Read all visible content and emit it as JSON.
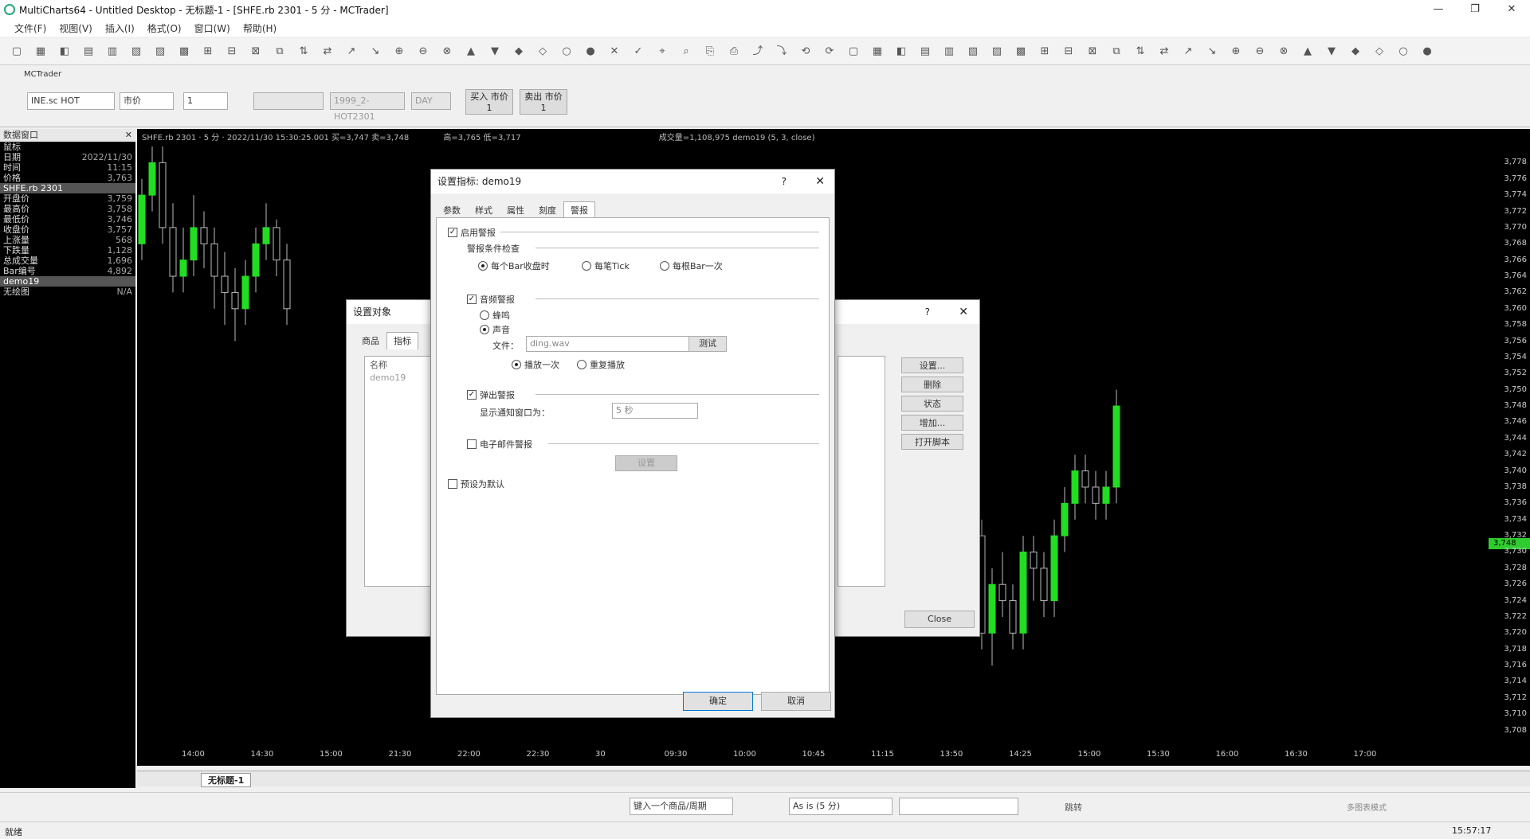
{
  "window": {
    "title": "MultiCharts64 - Untitled Desktop - 无标题-1 - [SHFE.rb 2301 - 5 分 - MCTrader]"
  },
  "menu": [
    "文件(F)",
    "视图(V)",
    "插入(I)",
    "格式(O)",
    "窗口(W)",
    "帮助(H)"
  ],
  "trade_bar": {
    "tab_label": "MCTrader",
    "symbol": "INE.sc HOT",
    "order_type": "市价",
    "quantity": "1",
    "account": "1999_2-HOT2301",
    "tif": "DAY",
    "buy_label": "买入 市价",
    "buy_qty": "1",
    "sell_label": "卖出 市价",
    "sell_qty": "1"
  },
  "data_window": {
    "header": "数据窗口",
    "rows": [
      {
        "k": "鼠标",
        "v": ""
      },
      {
        "k": "日期",
        "v": "2022/11/30"
      },
      {
        "k": "时间",
        "v": "11:15"
      },
      {
        "k": "价格",
        "v": "3,763"
      },
      {
        "k": "SHFE.rb 2301",
        "v": "",
        "sel": true
      },
      {
        "k": "开盘价",
        "v": "3,759"
      },
      {
        "k": "最高价",
        "v": "3,758"
      },
      {
        "k": "最低价",
        "v": "3,746"
      },
      {
        "k": "收盘价",
        "v": "3,757"
      },
      {
        "k": "上涨量",
        "v": "568"
      },
      {
        "k": "下跌量",
        "v": "1,128"
      },
      {
        "k": "总成交量",
        "v": "1,696"
      },
      {
        "k": "Bar编号",
        "v": "4,892"
      },
      {
        "k": "demo19",
        "v": "",
        "sel": true
      },
      {
        "k": "无绘图",
        "v": "N/A"
      }
    ]
  },
  "chart": {
    "status_line": "SHFE.rb 2301 · 5 分 · 2022/11/30  15:30:25.001  买=3,747  卖=3,748",
    "status_hilo": "高=3,765  低=3,717",
    "status_vol": "成交量=1,108,975   demo19  (5, 3, close)",
    "last_price": "3,748",
    "y_ticks": [
      "3,778",
      "3,776",
      "3,774",
      "3,772",
      "3,770",
      "3,768",
      "3,766",
      "3,764",
      "3,762",
      "3,760",
      "3,758",
      "3,756",
      "3,754",
      "3,752",
      "3,750",
      "3,748",
      "3,746",
      "3,744",
      "3,742",
      "3,740",
      "3,738",
      "3,736",
      "3,734",
      "3,732",
      "3,730",
      "3,728",
      "3,726",
      "3,724",
      "3,722",
      "3,720",
      "3,718",
      "3,716",
      "3,714",
      "3,712",
      "3,710",
      "3,708"
    ],
    "x_ticks": [
      "14:00",
      "14:30",
      "15:00",
      "21:30",
      "22:00",
      "22:30",
      "30",
      "09:30",
      "10:00",
      "10:45",
      "11:15",
      "13:50",
      "14:25",
      "15:00",
      "15:30",
      "16:00",
      "16:30",
      "17:00"
    ]
  },
  "chart_data": {
    "type": "candlestick",
    "ylim": [
      3706,
      3780
    ],
    "up_color": "#22dd22",
    "down_color": "#000000",
    "candles_left": [
      {
        "o": 3768,
        "c": 3774,
        "h": 3776,
        "l": 3766
      },
      {
        "o": 3774,
        "c": 3778,
        "h": 3780,
        "l": 3772
      },
      {
        "o": 3778,
        "c": 3770,
        "h": 3780,
        "l": 3768
      },
      {
        "o": 3770,
        "c": 3764,
        "h": 3773,
        "l": 3762
      },
      {
        "o": 3764,
        "c": 3766,
        "h": 3770,
        "l": 3762
      },
      {
        "o": 3766,
        "c": 3770,
        "h": 3774,
        "l": 3764
      },
      {
        "o": 3770,
        "c": 3768,
        "h": 3772,
        "l": 3765
      },
      {
        "o": 3768,
        "c": 3764,
        "h": 3770,
        "l": 3760
      },
      {
        "o": 3764,
        "c": 3762,
        "h": 3767,
        "l": 3758
      },
      {
        "o": 3762,
        "c": 3760,
        "h": 3765,
        "l": 3756
      },
      {
        "o": 3760,
        "c": 3764,
        "h": 3766,
        "l": 3758
      },
      {
        "o": 3764,
        "c": 3768,
        "h": 3770,
        "l": 3762
      },
      {
        "o": 3768,
        "c": 3770,
        "h": 3773,
        "l": 3766
      },
      {
        "o": 3770,
        "c": 3766,
        "h": 3771,
        "l": 3764
      },
      {
        "o": 3766,
        "c": 3760,
        "h": 3768,
        "l": 3758
      }
    ],
    "candles_right": [
      {
        "o": 3732,
        "c": 3720,
        "h": 3734,
        "l": 3718
      },
      {
        "o": 3720,
        "c": 3726,
        "h": 3728,
        "l": 3716
      },
      {
        "o": 3726,
        "c": 3724,
        "h": 3730,
        "l": 3722
      },
      {
        "o": 3724,
        "c": 3720,
        "h": 3726,
        "l": 3718
      },
      {
        "o": 3720,
        "c": 3730,
        "h": 3732,
        "l": 3718
      },
      {
        "o": 3730,
        "c": 3728,
        "h": 3732,
        "l": 3724
      },
      {
        "o": 3728,
        "c": 3724,
        "h": 3730,
        "l": 3722
      },
      {
        "o": 3724,
        "c": 3732,
        "h": 3734,
        "l": 3722
      },
      {
        "o": 3732,
        "c": 3736,
        "h": 3738,
        "l": 3730
      },
      {
        "o": 3736,
        "c": 3740,
        "h": 3742,
        "l": 3734
      },
      {
        "o": 3740,
        "c": 3738,
        "h": 3742,
        "l": 3736
      },
      {
        "o": 3738,
        "c": 3736,
        "h": 3740,
        "l": 3734
      },
      {
        "o": 3736,
        "c": 3738,
        "h": 3740,
        "l": 3734
      },
      {
        "o": 3738,
        "c": 3748,
        "h": 3750,
        "l": 3736
      }
    ]
  },
  "bg_dialog": {
    "title": "设置对象",
    "tabs": [
      "商品",
      "指标"
    ],
    "list_header": "名称",
    "list_items": [
      "demo19"
    ],
    "buttons": [
      "设置...",
      "删除",
      "状态",
      "增加...",
      "打开脚本"
    ],
    "close": "Close"
  },
  "dialog": {
    "title": "设置指标: demo19",
    "help": "?",
    "tabs": [
      "参数",
      "样式",
      "属性",
      "刻度",
      "警报"
    ],
    "enable_alert": "启用警报",
    "condition_label": "警报条件检查",
    "cond_options": [
      "每个Bar收盘时",
      "每笔Tick",
      "每根Bar一次"
    ],
    "audio_alert": "音频警报",
    "beep": "蜂鸣",
    "sound": "声音",
    "file_label": "文件：",
    "file_value": "ding.wav",
    "test": "测试",
    "play_once": "播放一次",
    "repeat": "重复播放",
    "popup_alert": "弹出警报",
    "notify_label": "显示通知窗口为：",
    "notify_value": "5 秒",
    "email_alert": "电子邮件警报",
    "email_settings": "设置",
    "preset_default": "预设为默认",
    "ok": "确定",
    "cancel": "取消"
  },
  "sheet_tab": "无标题-1",
  "drawbar": {
    "symbol_input_placeholder": "键入一个商品/周期",
    "resolution": "As is (5 分)",
    "jump": "跳转",
    "mode": "多图表模式"
  },
  "status": {
    "left": "就绪",
    "time": "15:57:17"
  }
}
